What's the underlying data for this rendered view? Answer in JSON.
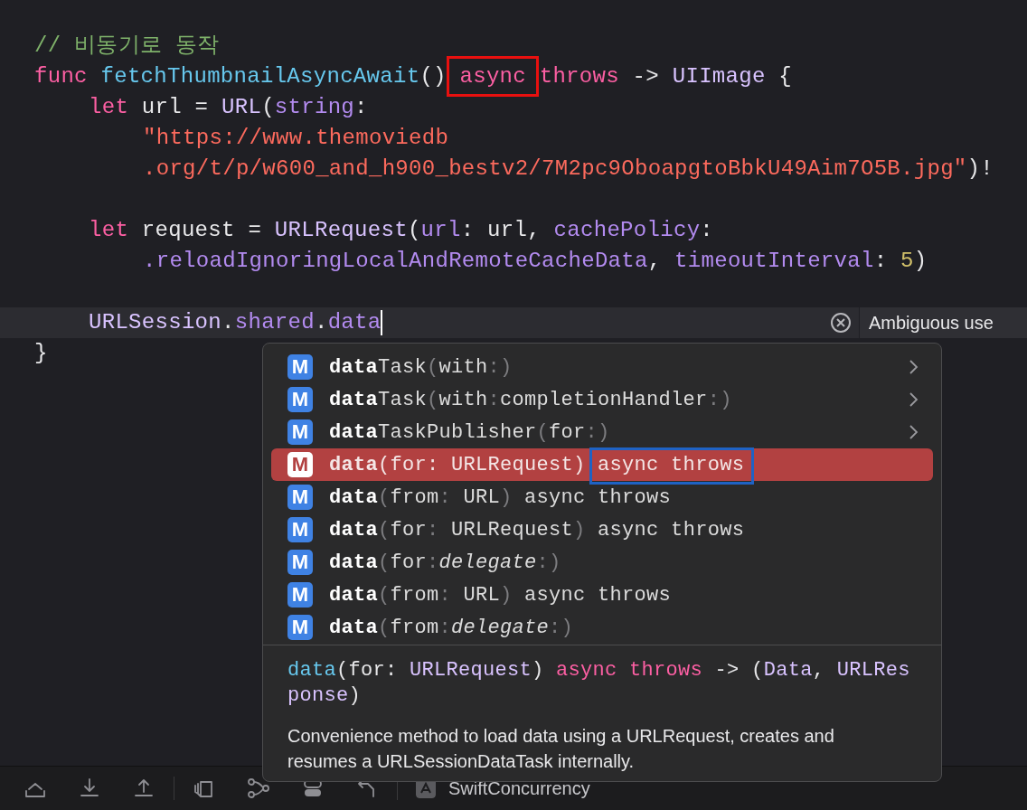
{
  "editor": {
    "lines": [
      {
        "kind": "code",
        "tokens": [
          {
            "text": "// 비동기로 동작",
            "kind": "comment"
          }
        ]
      },
      {
        "kind": "code",
        "tokens": [
          {
            "text": "func ",
            "kind": "kw"
          },
          {
            "text": "fetchThumbnailAsyncAwait",
            "kind": "fn"
          },
          {
            "text": "() ",
            "kind": "plain"
          },
          {
            "text": "async",
            "kind": "kw",
            "marked": true
          },
          {
            "text": " throws",
            "kind": "kw"
          },
          {
            "text": " -> ",
            "kind": "plain"
          },
          {
            "text": "UIImage",
            "kind": "type"
          },
          {
            "text": " {",
            "kind": "plain"
          }
        ],
        "children": [
          {
            "kind": "code",
            "tokens": [
              {
                "text": "let",
                "kind": "kw"
              },
              {
                "text": " url = ",
                "kind": "plain"
              },
              {
                "text": "URL",
                "kind": "type"
              },
              {
                "text": "(",
                "kind": "plain"
              },
              {
                "text": "string",
                "kind": "param"
              },
              {
                "text": ":",
                "kind": "plain"
              }
            ],
            "children": [
              {
                "kind": "code",
                "tokens": [
                  {
                    "text": "\"https://www.themoviedb",
                    "kind": "str"
                  }
                ]
              },
              {
                "kind": "code",
                "tokens": [
                  {
                    "text": ".org/t/p/w600_and_h900_bestv2/7M2pc9OboapgtoBbkU49Aim7O5B.jpg\"",
                    "kind": "str"
                  },
                  {
                    "text": ")!",
                    "kind": "plain"
                  }
                ]
              }
            ]
          },
          {
            "kind": "blank"
          },
          {
            "kind": "code",
            "tokens": [
              {
                "text": "let",
                "kind": "kw"
              },
              {
                "text": " request = ",
                "kind": "plain"
              },
              {
                "text": "URLRequest",
                "kind": "type"
              },
              {
                "text": "(",
                "kind": "plain"
              },
              {
                "text": "url",
                "kind": "param"
              },
              {
                "text": ": url, ",
                "kind": "plain"
              },
              {
                "text": "cachePolicy",
                "kind": "param"
              },
              {
                "text": ":",
                "kind": "plain"
              }
            ],
            "children": [
              {
                "kind": "code",
                "tokens": [
                  {
                    "text": ".reloadIgnoringLocalAndRemoteCacheData",
                    "kind": "prop"
                  },
                  {
                    "text": ", ",
                    "kind": "plain"
                  },
                  {
                    "text": "timeoutInterval",
                    "kind": "param"
                  },
                  {
                    "text": ": ",
                    "kind": "plain"
                  },
                  {
                    "text": "5",
                    "kind": "num"
                  },
                  {
                    "text": ")",
                    "kind": "plain"
                  }
                ]
              }
            ]
          },
          {
            "kind": "blank"
          },
          {
            "kind": "code",
            "current": true,
            "error": "Ambiguous use",
            "tokens": [
              {
                "text": "URLSession",
                "kind": "type"
              },
              {
                "text": ".",
                "kind": "plain"
              },
              {
                "text": "shared",
                "kind": "prop"
              },
              {
                "text": ".",
                "kind": "plain"
              },
              {
                "text": "data",
                "kind": "prop"
              }
            ]
          }
        ]
      },
      {
        "kind": "code",
        "tokens": [
          {
            "text": "}",
            "kind": "plain"
          }
        ]
      }
    ]
  },
  "completion": {
    "items": [
      {
        "icon": "M",
        "selected": false,
        "has_children": true,
        "parts": [
          {
            "text": "data",
            "kind": "match"
          },
          {
            "text": "Task",
            "kind": "text"
          },
          {
            "text": "(",
            "kind": "dim"
          },
          {
            "text": "with",
            "kind": "text"
          },
          {
            "text": ":)",
            "kind": "dim"
          }
        ]
      },
      {
        "icon": "M",
        "selected": false,
        "has_children": true,
        "parts": [
          {
            "text": "data",
            "kind": "match"
          },
          {
            "text": "Task",
            "kind": "text"
          },
          {
            "text": "(",
            "kind": "dim"
          },
          {
            "text": "with",
            "kind": "text"
          },
          {
            "text": ":",
            "kind": "dim"
          },
          {
            "text": "completionHandler",
            "kind": "text"
          },
          {
            "text": ":)",
            "kind": "dim"
          }
        ]
      },
      {
        "icon": "M",
        "selected": false,
        "has_children": true,
        "parts": [
          {
            "text": "data",
            "kind": "match"
          },
          {
            "text": "TaskPublisher",
            "kind": "text"
          },
          {
            "text": "(",
            "kind": "dim"
          },
          {
            "text": "for",
            "kind": "text"
          },
          {
            "text": ":)",
            "kind": "dim"
          }
        ]
      },
      {
        "icon": "M",
        "selected": true,
        "has_children": false,
        "parts": [
          {
            "text": "data",
            "kind": "match"
          },
          {
            "text": "(",
            "kind": "dim"
          },
          {
            "text": "for",
            "kind": "text"
          },
          {
            "text": ": ",
            "kind": "dim"
          },
          {
            "text": "URLRequest",
            "kind": "text"
          },
          {
            "text": ") ",
            "kind": "dim"
          },
          {
            "text": "async throws",
            "kind": "text",
            "marked": true
          }
        ]
      },
      {
        "icon": "M",
        "selected": false,
        "has_children": false,
        "parts": [
          {
            "text": "data",
            "kind": "match"
          },
          {
            "text": "(",
            "kind": "dim"
          },
          {
            "text": "from",
            "kind": "text"
          },
          {
            "text": ": ",
            "kind": "dim"
          },
          {
            "text": "URL",
            "kind": "text"
          },
          {
            "text": ")",
            "kind": "dim"
          },
          {
            "text": " async throws",
            "kind": "text"
          }
        ]
      },
      {
        "icon": "M",
        "selected": false,
        "has_children": false,
        "parts": [
          {
            "text": "data",
            "kind": "match"
          },
          {
            "text": "(",
            "kind": "dim"
          },
          {
            "text": "for",
            "kind": "text"
          },
          {
            "text": ": ",
            "kind": "dim"
          },
          {
            "text": "URLRequest",
            "kind": "text"
          },
          {
            "text": ")",
            "kind": "dim"
          },
          {
            "text": " async throws",
            "kind": "text"
          }
        ]
      },
      {
        "icon": "M",
        "selected": false,
        "has_children": false,
        "parts": [
          {
            "text": "data",
            "kind": "match"
          },
          {
            "text": "(",
            "kind": "dim"
          },
          {
            "text": "for",
            "kind": "text"
          },
          {
            "text": ":",
            "kind": "dim"
          },
          {
            "text": "delegate",
            "kind": "italic"
          },
          {
            "text": ":)",
            "kind": "dim"
          }
        ]
      },
      {
        "icon": "M",
        "selected": false,
        "has_children": false,
        "parts": [
          {
            "text": "data",
            "kind": "match"
          },
          {
            "text": "(",
            "kind": "dim"
          },
          {
            "text": "from",
            "kind": "text"
          },
          {
            "text": ": ",
            "kind": "dim"
          },
          {
            "text": "URL",
            "kind": "text"
          },
          {
            "text": ")",
            "kind": "dim"
          },
          {
            "text": " async throws",
            "kind": "text"
          }
        ]
      },
      {
        "icon": "M",
        "selected": false,
        "has_children": false,
        "parts": [
          {
            "text": "data",
            "kind": "match"
          },
          {
            "text": "(",
            "kind": "dim"
          },
          {
            "text": "from",
            "kind": "text"
          },
          {
            "text": ":",
            "kind": "dim"
          },
          {
            "text": "delegate",
            "kind": "italic"
          },
          {
            "text": ":)",
            "kind": "dim"
          }
        ]
      }
    ],
    "doc": {
      "signature": [
        {
          "text": "data",
          "kind": "fn"
        },
        {
          "text": "(for: ",
          "kind": "plain"
        },
        {
          "text": "URLRequest",
          "kind": "type"
        },
        {
          "text": ") ",
          "kind": "plain"
        },
        {
          "text": "async throws",
          "kind": "kw"
        },
        {
          "text": " -> (",
          "kind": "plain"
        },
        {
          "text": "Data",
          "kind": "type"
        },
        {
          "text": ", ",
          "kind": "plain"
        },
        {
          "text": "URLResponse",
          "kind": "type"
        },
        {
          "text": ")",
          "kind": "plain"
        }
      ],
      "description": "Convenience method to load data using a URLRequest, creates and resumes a URLSessionDataTask internally."
    }
  },
  "toolbar": {
    "scheme": "SwiftConcurrency"
  }
}
